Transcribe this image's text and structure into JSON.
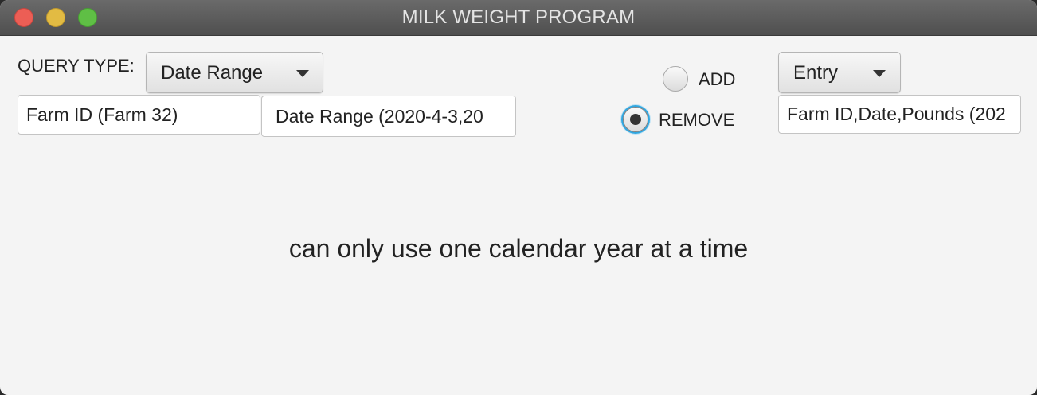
{
  "window": {
    "title": "MILK WEIGHT PROGRAM"
  },
  "query": {
    "type_label": "QUERY TYPE:",
    "type_selected": "Date Range",
    "farm_field_value": "Farm ID (Farm 32)",
    "date_field_value": "Date Range (2020-4-3,20"
  },
  "mode": {
    "options": [
      {
        "label": "ADD",
        "selected": false
      },
      {
        "label": "REMOVE",
        "selected": true
      }
    ]
  },
  "entry": {
    "type_selected": "Entry",
    "field_value": "Farm ID,Date,Pounds (202"
  },
  "status": {
    "message": "can only use one calendar year at a time"
  },
  "colors": {
    "window_bg": "#f4f4f4",
    "titlebar": "#5a5a5a",
    "radio_focus": "#2fa6e0",
    "close": "#ec5e55",
    "minimize": "#e2bb43",
    "zoom": "#5fbf45"
  }
}
